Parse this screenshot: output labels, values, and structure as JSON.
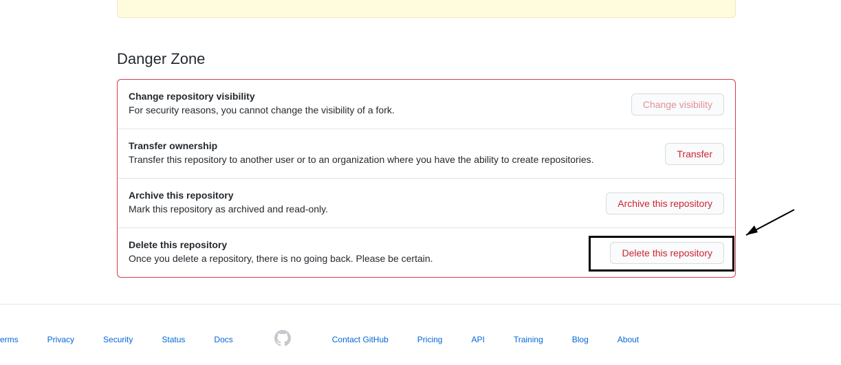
{
  "section": {
    "title": "Danger Zone"
  },
  "rows": {
    "visibility": {
      "title": "Change repository visibility",
      "desc": "For security reasons, you cannot change the visibility of a fork.",
      "button": "Change visibility"
    },
    "transfer": {
      "title": "Transfer ownership",
      "desc": "Transfer this repository to another user or to an organization where you have the ability to create repositories.",
      "button": "Transfer"
    },
    "archive": {
      "title": "Archive this repository",
      "desc": "Mark this repository as archived and read-only.",
      "button": "Archive this repository"
    },
    "delete": {
      "title": "Delete this repository",
      "desc": "Once you delete a repository, there is no going back. Please be certain.",
      "button": "Delete this repository"
    }
  },
  "footer": {
    "terms": "erms",
    "privacy": "Privacy",
    "security": "Security",
    "status": "Status",
    "docs": "Docs",
    "contact": "Contact GitHub",
    "pricing": "Pricing",
    "api": "API",
    "training": "Training",
    "blog": "Blog",
    "about": "About"
  }
}
